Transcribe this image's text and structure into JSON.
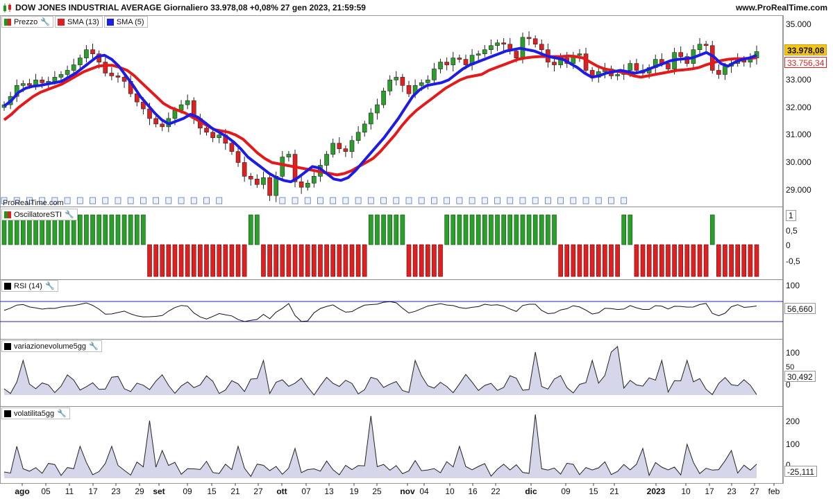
{
  "header": {
    "title": "DOW JONES INDUSTRIAL AVERAGE Giornaliero 33.978,08 +0,08% 27 gen 2023, 21:59:59",
    "site": "www.ProRealTime.com",
    "watermark": "ProRealTime.com"
  },
  "price_panel": {
    "legend": [
      {
        "label": "Prezzo",
        "color": "#1a9a1a",
        "icon": "wrench-icon"
      },
      {
        "label": "SMA (13)",
        "color": "#e02020",
        "icon": "wrench-icon"
      },
      {
        "label": "SMA (5)",
        "color": "#1f1fe0",
        "icon": "wrench-icon"
      }
    ],
    "y_ticks": [
      "35.000",
      "34.000",
      "33.000",
      "32.000",
      "31.000",
      "30.000",
      "29.000"
    ],
    "last_price": "33.978,08",
    "sma13_value": "33.756,34"
  },
  "osc_panel": {
    "label": "OscillatoreSTI",
    "y_ticks": [
      "1",
      "0,5",
      "0",
      "-0,5"
    ]
  },
  "rsi_panel": {
    "label": "RSI (14)",
    "y_ticks": [
      "100"
    ],
    "value": "56,660"
  },
  "volvar_panel": {
    "label": "variazionevolume5gg",
    "y_ticks": [
      "100",
      "50",
      "0"
    ],
    "value": "30,492"
  },
  "volat_panel": {
    "label": "volatilita5gg",
    "y_ticks": [
      "200",
      "100",
      "0"
    ],
    "value": "-25,111"
  },
  "x_axis": {
    "labels": [
      {
        "t": "ago",
        "bold": true
      },
      {
        "t": "05"
      },
      {
        "t": "11"
      },
      {
        "t": "17"
      },
      {
        "t": "23"
      },
      {
        "t": "29"
      },
      {
        "t": "set",
        "bold": true
      },
      {
        "t": "09"
      },
      {
        "t": "15"
      },
      {
        "t": "21"
      },
      {
        "t": "27"
      },
      {
        "t": "ott",
        "bold": true
      },
      {
        "t": "07"
      },
      {
        "t": "13"
      },
      {
        "t": "19"
      },
      {
        "t": "25"
      },
      {
        "t": "nov",
        "bold": true
      },
      {
        "t": "04"
      },
      {
        "t": "10"
      },
      {
        "t": "16"
      },
      {
        "t": "22"
      },
      {
        "t": "dic",
        "bold": true
      },
      {
        "t": "09"
      },
      {
        "t": "15"
      },
      {
        "t": "21"
      },
      {
        "t": "2023",
        "bold": true
      },
      {
        "t": "10"
      },
      {
        "t": "17"
      },
      {
        "t": "23"
      },
      {
        "t": "27"
      },
      {
        "t": "feb"
      }
    ]
  },
  "chart_data": {
    "type": "candlestick",
    "close": [
      32.05,
      32.35,
      32.75,
      32.82,
      32.75,
      32.95,
      32.85,
      32.9,
      33.05,
      33.15,
      33.3,
      33.5,
      33.75,
      34.05,
      33.9,
      33.6,
      33.2,
      33.1,
      33.05,
      32.9,
      32.45,
      32.15,
      31.9,
      31.55,
      31.35,
      31.25,
      31.55,
      31.85,
      32.05,
      32.2,
      31.55,
      31.2,
      31.05,
      30.85,
      30.95,
      30.65,
      30.35,
      29.95,
      29.45,
      29.35,
      29.15,
      29.4,
      28.75,
      29.45,
      30.15,
      30.25,
      29.25,
      29.05,
      29.2,
      29.45,
      29.85,
      30.25,
      30.65,
      30.45,
      30.35,
      30.75,
      31.05,
      31.35,
      31.75,
      32.05,
      32.55,
      32.95,
      33.05,
      32.75,
      32.45,
      32.75,
      32.85,
      32.95,
      33.35,
      33.6,
      33.5,
      33.75,
      33.7,
      33.5,
      33.85,
      33.9,
      34.05,
      34.2,
      34.3,
      34.25,
      34.0,
      33.75,
      34.5,
      34.45,
      34.25,
      34.05,
      33.6,
      33.5,
      33.75,
      33.55,
      33.85,
      33.9,
      33.3,
      33.05,
      33.25,
      33.35,
      33.1,
      33.15,
      33.3,
      33.55,
      33.3,
      33.2,
      33.4,
      33.7,
      33.55,
      33.35,
      33.95,
      33.8,
      33.55,
      34.05,
      34.25,
      34.2,
      33.3,
      33.15,
      33.45,
      33.55,
      33.7,
      33.6,
      33.75,
      33.98
    ],
    "sma13": [
      31.5,
      31.7,
      31.95,
      32.15,
      32.35,
      32.5,
      32.6,
      32.7,
      32.8,
      32.95,
      33.1,
      33.25,
      33.35,
      33.45,
      33.48,
      33.48,
      33.4,
      33.3,
      33.1,
      32.85,
      32.6,
      32.35,
      32.1,
      31.95,
      31.85,
      31.75,
      31.6,
      31.45,
      31.3,
      31.15,
      31.1,
      31.05,
      30.95,
      30.8,
      30.55,
      30.3,
      30.1,
      29.95,
      29.9,
      29.85,
      29.8,
      29.75,
      29.7,
      29.65,
      29.6,
      29.55,
      29.5,
      29.55,
      29.65,
      29.8,
      29.95,
      30.1,
      30.35,
      30.65,
      30.95,
      31.3,
      31.6,
      31.85,
      32.05,
      32.25,
      32.45,
      32.65,
      32.8,
      32.95,
      33.05,
      33.1,
      33.15,
      33.3,
      33.4,
      33.5,
      33.6,
      33.7,
      33.75,
      33.78,
      33.8,
      33.8,
      33.8,
      33.8,
      33.82,
      33.8,
      33.75,
      33.6,
      33.45,
      33.35,
      33.3,
      33.25,
      33.2,
      33.1,
      33.05,
      33.1,
      33.15,
      33.2,
      33.25,
      33.3,
      33.32,
      33.35,
      33.4,
      33.5,
      33.58,
      33.65,
      33.7,
      33.72,
      33.72,
      33.74,
      33.756
    ],
    "sma5": [
      32.0,
      32.2,
      32.5,
      32.65,
      32.72,
      32.75,
      32.8,
      32.85,
      32.9,
      33.05,
      33.2,
      33.4,
      33.6,
      33.8,
      33.85,
      33.7,
      33.45,
      33.1,
      32.75,
      32.35,
      32.05,
      31.75,
      31.5,
      31.35,
      31.45,
      31.55,
      31.7,
      31.6,
      31.4,
      31.2,
      31.05,
      30.9,
      30.7,
      30.45,
      30.15,
      29.95,
      29.75,
      29.55,
      29.4,
      29.3,
      29.25,
      29.4,
      29.6,
      29.8,
      29.75,
      29.55,
      29.35,
      29.3,
      29.4,
      29.65,
      29.95,
      30.25,
      30.55,
      30.85,
      31.2,
      31.55,
      31.95,
      32.35,
      32.6,
      32.75,
      32.8,
      32.85,
      32.95,
      33.15,
      33.35,
      33.5,
      33.6,
      33.7,
      33.8,
      33.9,
      34.0,
      34.05,
      34.1,
      34.05,
      34.0,
      33.9,
      33.8,
      33.75,
      33.7,
      33.55,
      33.4,
      33.2,
      33.05,
      33.1,
      33.2,
      33.25,
      33.3,
      33.25,
      33.2,
      33.25,
      33.35,
      33.45,
      33.55,
      33.65,
      33.7,
      33.72,
      33.75,
      33.85,
      33.95,
      33.8,
      33.55,
      33.45,
      33.6,
      33.7,
      33.75,
      33.85
    ]
  }
}
